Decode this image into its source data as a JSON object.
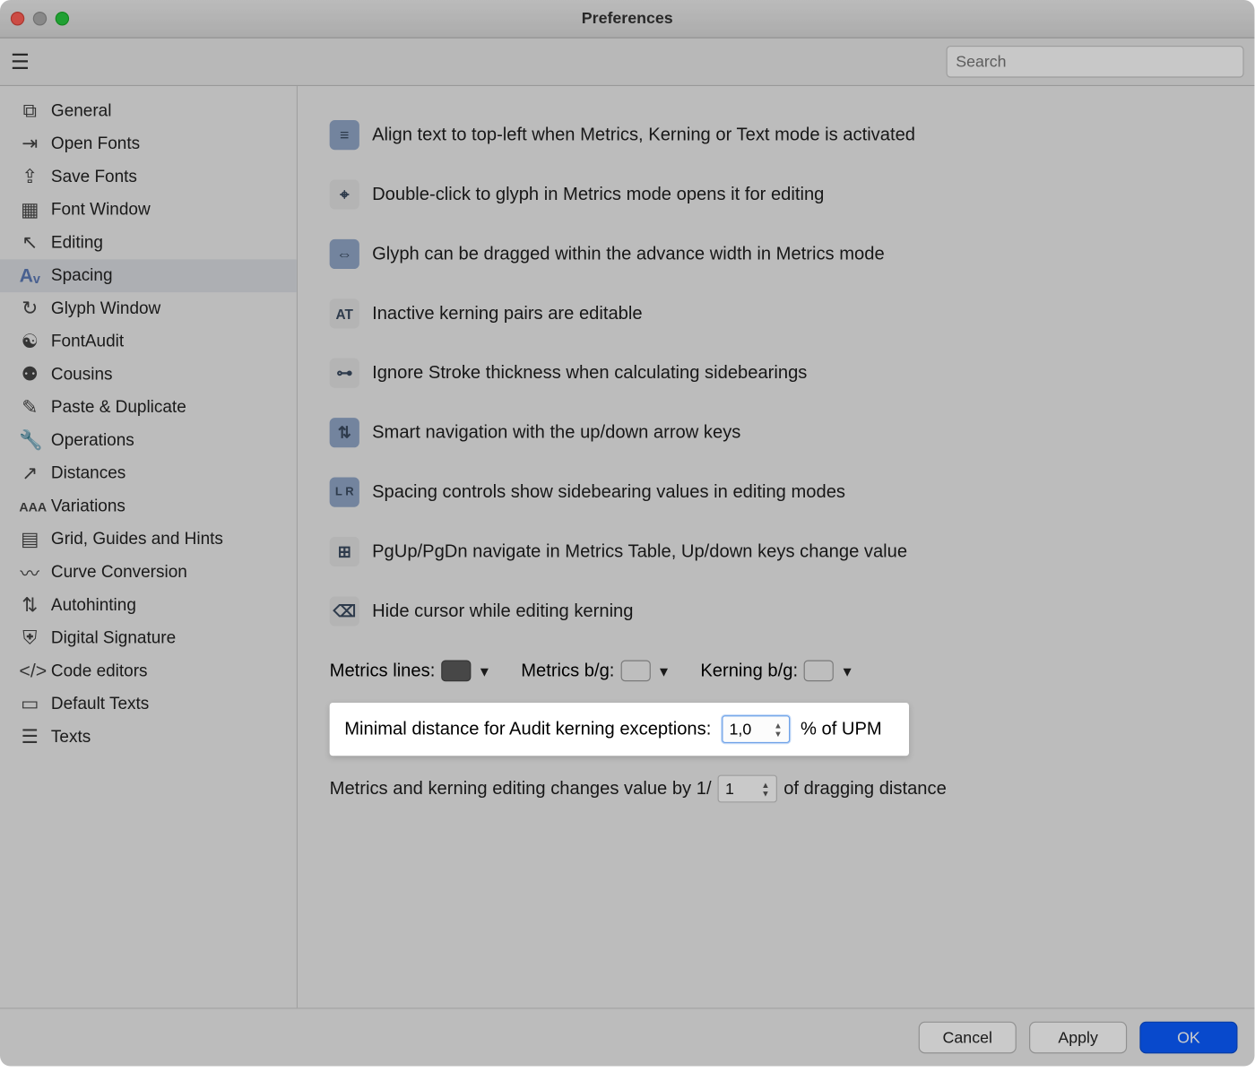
{
  "window": {
    "title": "Preferences"
  },
  "search": {
    "placeholder": "Search"
  },
  "sidebar": {
    "items": [
      {
        "label": "General"
      },
      {
        "label": "Open Fonts"
      },
      {
        "label": "Save Fonts"
      },
      {
        "label": "Font Window"
      },
      {
        "label": "Editing"
      },
      {
        "label": "Spacing"
      },
      {
        "label": "Glyph Window"
      },
      {
        "label": "FontAudit"
      },
      {
        "label": "Cousins"
      },
      {
        "label": "Paste & Duplicate"
      },
      {
        "label": "Operations"
      },
      {
        "label": "Distances"
      },
      {
        "label": "Variations"
      },
      {
        "label": "Grid, Guides and Hints"
      },
      {
        "label": "Curve Conversion"
      },
      {
        "label": "Autohinting"
      },
      {
        "label": "Digital Signature"
      },
      {
        "label": "Code editors"
      },
      {
        "label": "Default Texts"
      },
      {
        "label": "Texts"
      }
    ],
    "active_index": 5
  },
  "options": [
    {
      "on": true,
      "icon_name": "align-left-icon",
      "label": "Align text to top-left when Metrics, Kerning or Text mode is activated"
    },
    {
      "on": false,
      "icon_name": "cursor-click-icon",
      "label": "Double-click to glyph in Metrics mode opens it for editing"
    },
    {
      "on": true,
      "icon_name": "drag-width-icon",
      "label": "Glyph can be dragged within the advance width in Metrics mode"
    },
    {
      "on": false,
      "icon_name": "at-icon",
      "label": "Inactive kerning pairs are editable"
    },
    {
      "on": false,
      "icon_name": "stroke-icon",
      "label": "Ignore Stroke thickness when calculating sidebearings"
    },
    {
      "on": true,
      "icon_name": "arrows-updown-icon",
      "label": "Smart navigation with the up/down arrow keys"
    },
    {
      "on": true,
      "icon_name": "lr-values-icon",
      "label": "Spacing controls show sidebearing values in editing modes"
    },
    {
      "on": false,
      "icon_name": "pgupdn-icon",
      "label": "PgUp/PgDn navigate in Metrics Table, Up/down keys change value"
    },
    {
      "on": false,
      "icon_name": "hide-cursor-icon",
      "label": "Hide cursor while editing kerning"
    }
  ],
  "colors": {
    "metrics_lines_label": "Metrics lines:",
    "metrics_bg_label": "Metrics b/g:",
    "kerning_bg_label": "Kerning b/g:"
  },
  "audit": {
    "label_pre": "Minimal distance for Audit kerning exceptions:",
    "value": "1,0",
    "label_post": "% of UPM"
  },
  "drag": {
    "label_pre": "Metrics and kerning editing changes value by 1/",
    "value": "1",
    "label_post": "of dragging distance"
  },
  "footer": {
    "cancel": "Cancel",
    "apply": "Apply",
    "ok": "OK"
  }
}
